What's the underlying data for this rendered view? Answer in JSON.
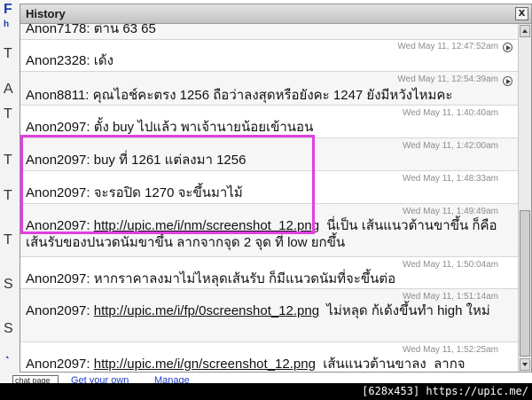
{
  "window": {
    "title": "History",
    "close_label": "X"
  },
  "background_page": {
    "glyphs": [
      "F",
      "h",
      "T",
      "A",
      "T",
      "T",
      "T",
      "T",
      "S",
      "S",
      "◔"
    ],
    "chat_input_value": "chat page",
    "links": [
      "Get your own",
      "Manage"
    ]
  },
  "messages": [
    {
      "text": "Anon7178: ต่าน 63 65",
      "stamp": "",
      "has_icon": false
    },
    {
      "text": "Anon2328: เด้ง",
      "stamp": "Wed May 11, 12:47:52am",
      "has_icon": true
    },
    {
      "text": "Anon8811: คุณไอช์คะตรง 1256 ถือว่าลงสุดหรือยังคะ 1247 ยังมีหวังไหมคะ",
      "stamp": "Wed May 11, 12:54:39am",
      "has_icon": true
    },
    {
      "text": "Anon2097: ตั้ง buy ไปแล้ว พาเจ้านายน้อยเข้านอน",
      "stamp": "Wed May 11, 1:40:40am",
      "has_icon": false
    },
    {
      "text": "Anon2097: buy ที่ 1261 แต่ลงมา 1256",
      "stamp": "Wed May 11, 1:42:00am",
      "has_icon": false
    },
    {
      "text": "Anon2097: จะรอปิด 1270 จะขึ้นมาไม้",
      "stamp": "Wed May 11, 1:48:33am",
      "has_icon": false
    },
    {
      "text_prefix": "Anon2097: ",
      "link": "http://upic.me/i/nm/screenshot_12.png",
      "text_suffix": "  นี่เป็น เส้นแนวต้านขาขึ้น ก็คือ  เส้นรับของปนวดนัมขาขึ้น ลากจากจุด 2 จุด ที่ low ยกขึ้น",
      "stamp": "Wed May 11, 1:49:49am",
      "has_icon": false
    },
    {
      "text": "Anon2097: หากราคาลงมาไม่ไหลุดเส้นรับ ก็มีแนวดนัมที่จะขึ้นต่อ",
      "stamp": "Wed May 11, 1:50:04am",
      "has_icon": false
    },
    {
      "text_prefix": "Anon2097: ",
      "link": "http://upic.me/i/fp/0screenshot_12.png",
      "text_suffix": "  ไม่หลุด ก้เด้งขึ้นทำ high ใหม่",
      "stamp": "Wed May 11, 1:51:14am",
      "has_icon": false
    },
    {
      "text_prefix": "Anon2097: ",
      "link": "http://upic.me/i/gn/screenshot_12.png",
      "text_suffix": "  เส้นแนวต้านขาลง  ลากจ",
      "stamp": "Wed May 11, 1:52:25am",
      "has_icon": false
    }
  ],
  "footer": {
    "text": "[628x453] https://upic.me/"
  },
  "colors": {
    "highlight": "#e23fe0",
    "link": "#1d3ec7"
  }
}
